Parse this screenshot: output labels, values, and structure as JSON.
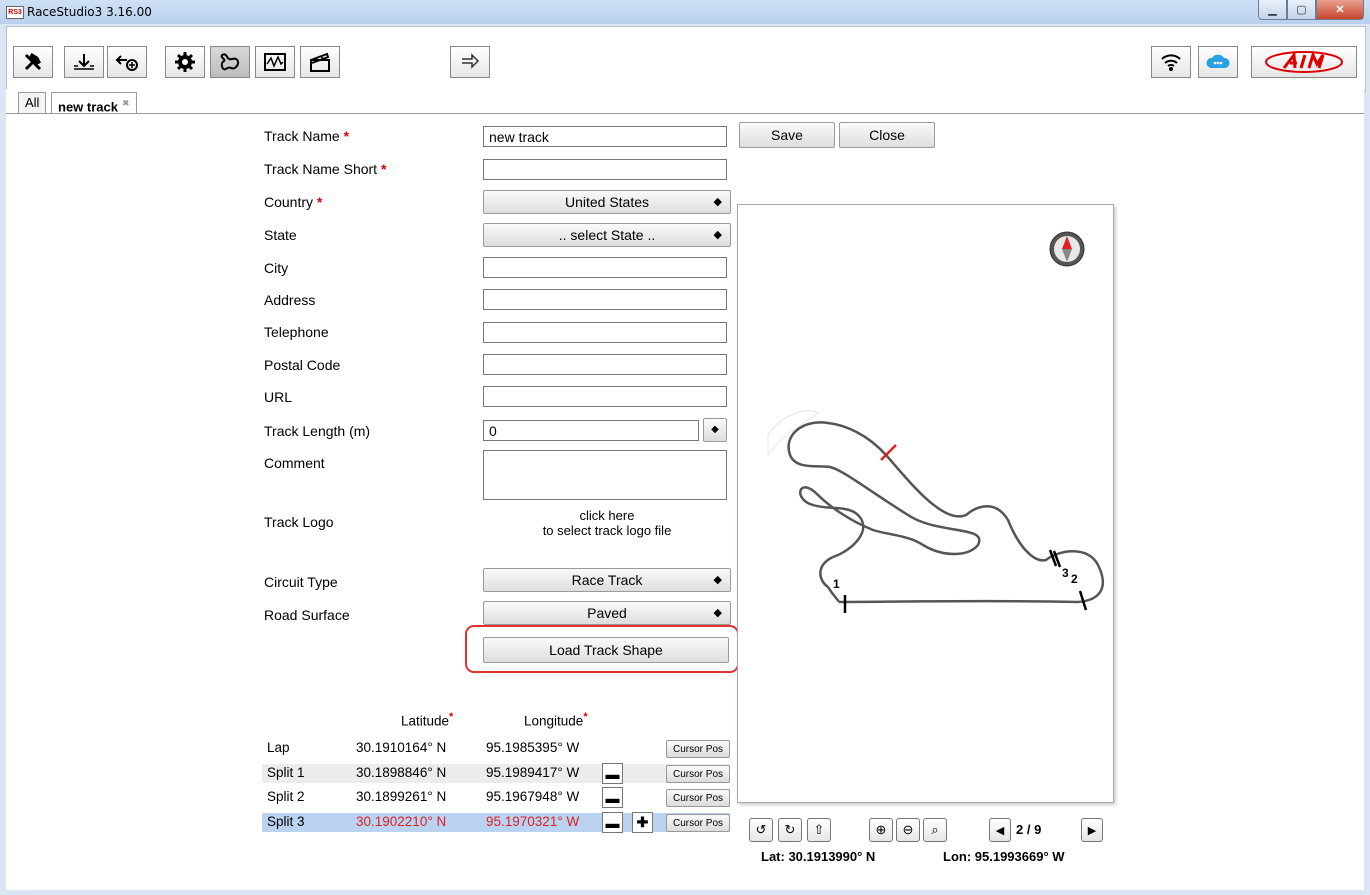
{
  "window": {
    "title": "RaceStudio3 3.16.00",
    "app_icon": "RS3"
  },
  "tabs": {
    "all": "All",
    "current": "new track"
  },
  "form": {
    "track_name_label": "Track Name",
    "track_name_value": "new track",
    "track_name_short_label": "Track Name Short",
    "country_label": "Country",
    "country_value": "United States",
    "state_label": "State",
    "state_value": ".. select State ..",
    "city_label": "City",
    "address_label": "Address",
    "telephone_label": "Telephone",
    "postal_code_label": "Postal Code",
    "url_label": "URL",
    "track_length_label": "Track Length (m)",
    "track_length_value": "0",
    "comment_label": "Comment",
    "track_logo_label": "Track Logo",
    "track_logo_hint_1": "click here",
    "track_logo_hint_2": "to select track logo file",
    "circuit_type_label": "Circuit Type",
    "circuit_type_value": "Race Track",
    "road_surface_label": "Road Surface",
    "road_surface_value": "Paved",
    "required_mark": "*"
  },
  "buttons": {
    "save": "Save",
    "close": "Close",
    "load_track_shape": "Load Track Shape",
    "cursor_pos": "Cursor Pos"
  },
  "coords": {
    "lat_header": "Latitude",
    "lon_header": "Longitude",
    "rows": [
      {
        "name": "Lap",
        "lat": "30.1910164° N",
        "lon": "95.1985395° W"
      },
      {
        "name": "Split 1",
        "lat": "30.1898846° N",
        "lon": "95.1989417° W"
      },
      {
        "name": "Split 2",
        "lat": "30.1899261° N",
        "lon": "95.1967948° W"
      },
      {
        "name": "Split 3",
        "lat": "30.1902210° N",
        "lon": "95.1970321° W"
      }
    ]
  },
  "map": {
    "page": "2 / 9",
    "lat_readout": "Lat: 30.1913990° N",
    "lon_readout": "Lon: 95.1993669° W",
    "markers": [
      "1",
      "2",
      "3"
    ]
  },
  "colors": {
    "required": "#e00000",
    "selected_row": "#b9d3f1",
    "highlight": "#e03030",
    "selected_text": "#e02020"
  }
}
